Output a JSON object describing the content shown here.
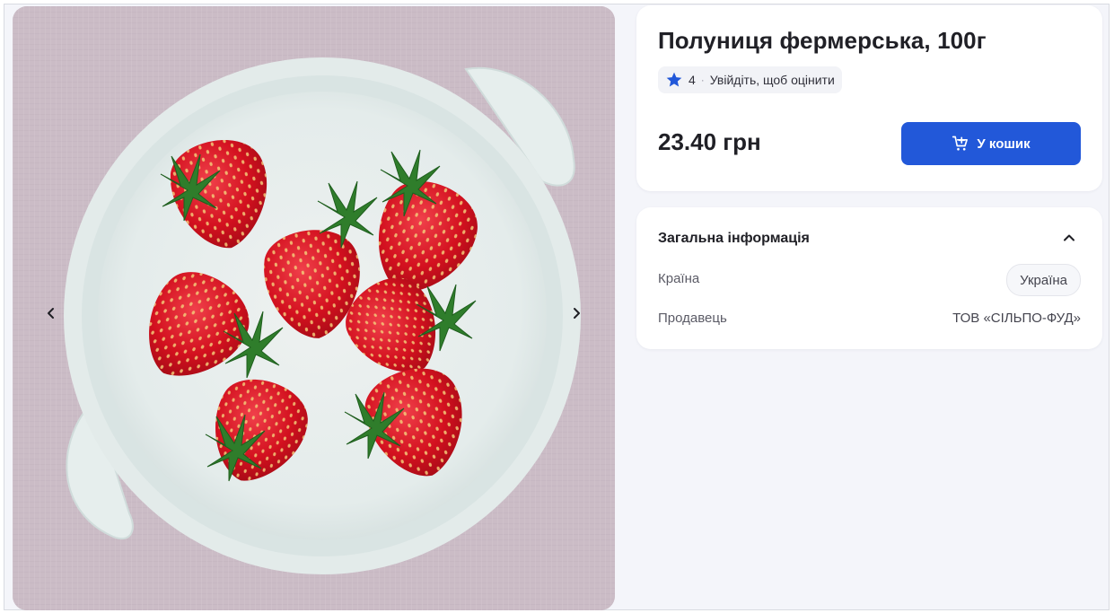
{
  "product": {
    "title": "Полуниця фермерська, 100г",
    "rating_value": "4",
    "rating_separator": "·",
    "rating_prompt": "Увійдіть, щоб оцінити",
    "price": "23.40 грн",
    "cart_label": "У кошик"
  },
  "info": {
    "heading": "Загальна інформація",
    "rows": [
      {
        "label": "Країна",
        "value": "Україна"
      },
      {
        "label": "Продавець",
        "value": "ТОВ «СІЛЬПО-ФУД»"
      }
    ]
  },
  "icons": {
    "star": "star-icon",
    "cart": "cart-add-icon",
    "collapse": "chevron-up-icon",
    "prev": "chevron-left-icon",
    "next": "chevron-right-icon"
  },
  "colors": {
    "accent": "#2258d9",
    "page_bg": "#f4f5fa",
    "card_bg": "#ffffff"
  }
}
